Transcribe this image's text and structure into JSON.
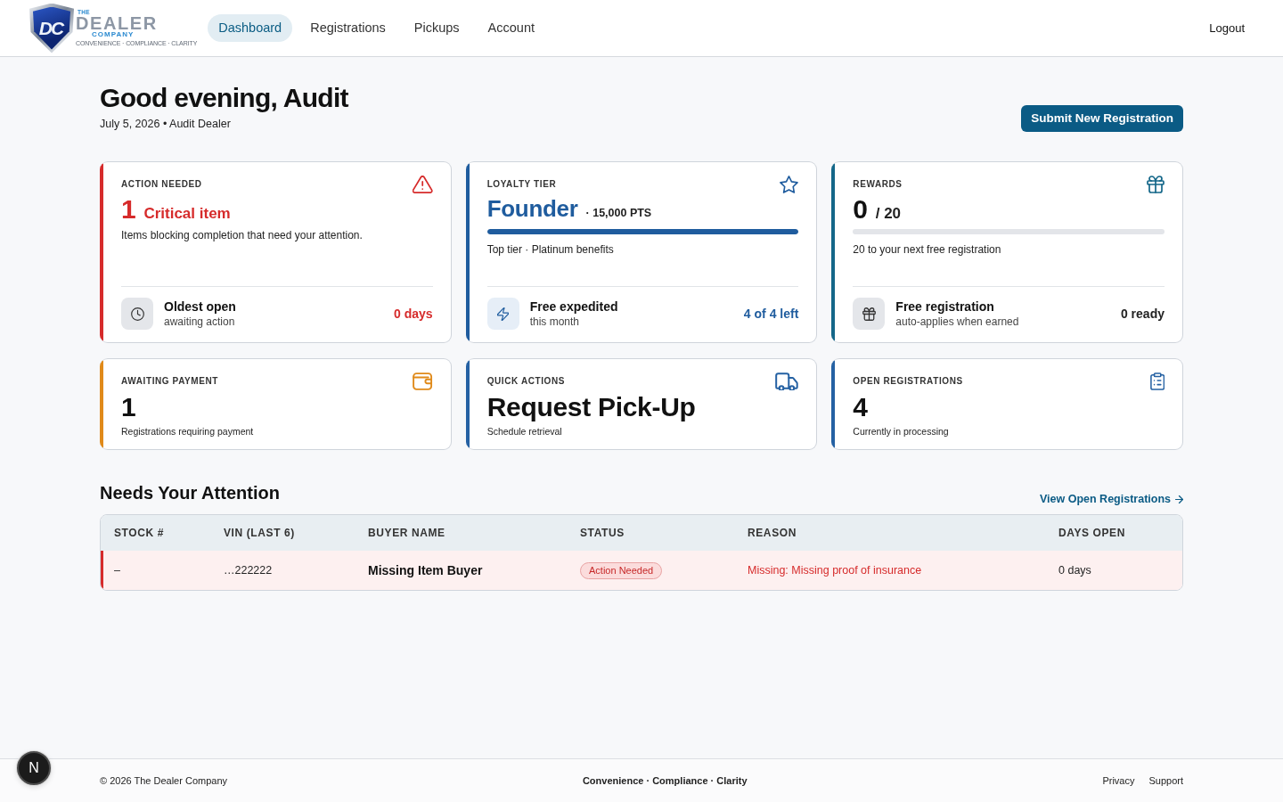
{
  "header": {
    "logo": {
      "mark": "DC",
      "line_1": "THE",
      "line_2": "DEALER",
      "line_3": "COMPANY",
      "tagline": "CONVENIENCE · COMPLIANCE · CLARITY"
    },
    "nav": [
      {
        "label": "Dashboard",
        "selected": true
      },
      {
        "label": "Registrations",
        "selected": false
      },
      {
        "label": "Pickups",
        "selected": false
      },
      {
        "label": "Account",
        "selected": false
      }
    ],
    "logout": "Logout"
  },
  "greeting": {
    "title": "Good evening, Audit",
    "subtitle": "July 5, 2026 • Audit Dealer",
    "button": "Submit New Registration"
  },
  "cards": [
    {
      "kind": "alert",
      "color": "#d62b2b",
      "label": "ACTION NEEDED",
      "value": "1",
      "unit": "Critical item",
      "description": "Items blocking completion that need your attention.",
      "footer": {
        "title": "Oldest open",
        "subtitle": "awaiting action",
        "value": "0 days"
      }
    },
    {
      "kind": "tier",
      "color": "#1f5c9e",
      "label": "LOYALTY TIER",
      "value": "Founder",
      "unit": "· 15,000 PTS",
      "level": 1,
      "description": "Top tier · Platinum benefits",
      "footer": {
        "title": "Free expedited",
        "subtitle": "this month",
        "value": "4 of 4 left"
      }
    },
    {
      "kind": "reward",
      "color": "#146789",
      "label": "REWARDS",
      "value": "0",
      "unit": "/ 20",
      "level": 0,
      "description": "20 to your next free registration",
      "footer": {
        "title": "Free registration",
        "subtitle": "auto-applies when earned",
        "value": "0 ready"
      }
    },
    {
      "kind": "stat",
      "color": "#e08a1a",
      "label": "AWAITING PAYMENT",
      "value": "1",
      "description": "Registrations requiring payment"
    },
    {
      "kind": "stat",
      "color": "#2561a3",
      "label": "QUICK ACTIONS",
      "value": "Request Pick-Up",
      "description": "Schedule retrieval"
    },
    {
      "kind": "stat",
      "color": "#2561a3",
      "label": "OPEN REGISTRATIONS",
      "value": "4",
      "description": "Currently in processing"
    }
  ],
  "attention": {
    "title": "Needs Your Attention",
    "link": "View Open Registrations",
    "table": {
      "columns": [
        "STOCK #",
        "VIN (LAST 6)",
        "BUYER NAME",
        "STATUS",
        "REASON",
        "DAYS OPEN"
      ],
      "rows": [
        {
          "flagged": true,
          "cells": [
            "–",
            "…222222",
            "Missing Item Buyer",
            "Action Needed",
            "Missing: Missing proof of insurance",
            "0 days"
          ]
        }
      ]
    }
  },
  "footer": {
    "copyright": "© 2026 The Dealer Company",
    "tagline": "Convenience · Compliance · Clarity",
    "links": [
      "Privacy",
      "Support"
    ]
  },
  "dev_badge": "N"
}
